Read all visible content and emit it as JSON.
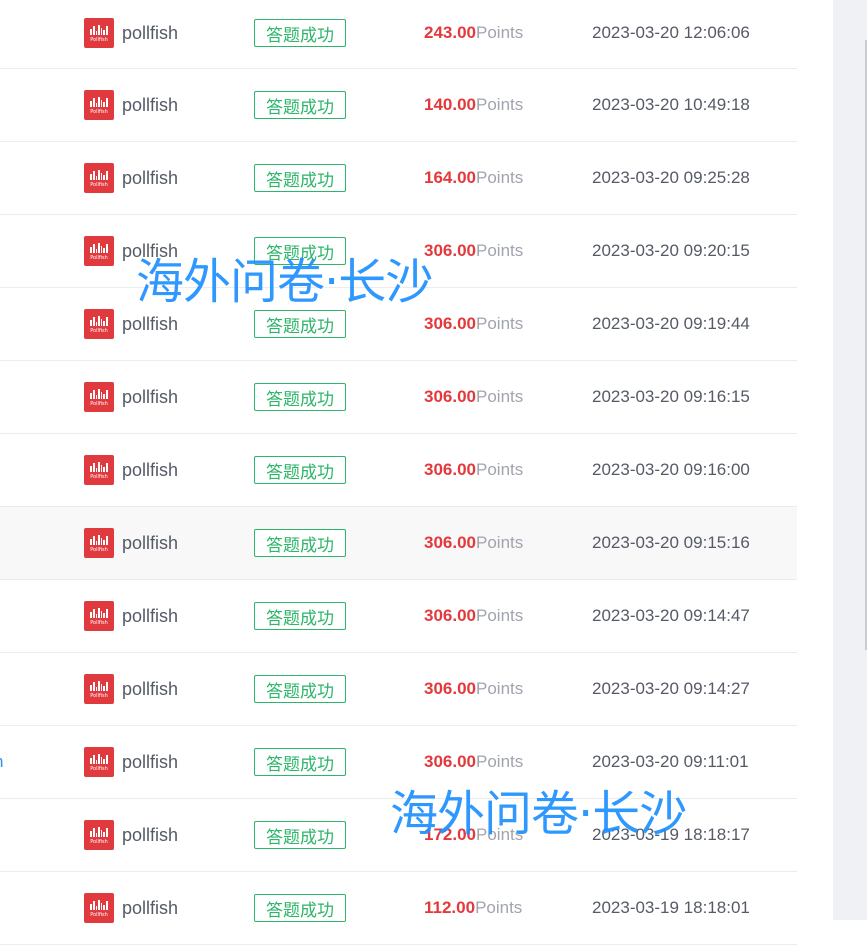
{
  "rows": [
    {
      "left_link": "",
      "vendor": "pollfish",
      "logo_text": "Pollfish",
      "status": "答题成功",
      "points": "243.00",
      "unit": "Points",
      "time": "2023-03-20 12:06:06",
      "highlight": false
    },
    {
      "left_link": "",
      "vendor": "pollfish",
      "logo_text": "Pollfish",
      "status": "答题成功",
      "points": "140.00",
      "unit": "Points",
      "time": "2023-03-20 10:49:18",
      "highlight": false
    },
    {
      "left_link": "",
      "vendor": "pollfish",
      "logo_text": "Pollfish",
      "status": "答题成功",
      "points": "164.00",
      "unit": "Points",
      "time": "2023-03-20 09:25:28",
      "highlight": false
    },
    {
      "left_link": "",
      "vendor": "pollfish",
      "logo_text": "Pollfish",
      "status": "答题成功",
      "points": "306.00",
      "unit": "Points",
      "time": "2023-03-20 09:20:15",
      "highlight": false
    },
    {
      "left_link": "",
      "vendor": "pollfish",
      "logo_text": "Pollfish",
      "status": "答题成功",
      "points": "306.00",
      "unit": "Points",
      "time": "2023-03-20 09:19:44",
      "highlight": false
    },
    {
      "left_link": "",
      "vendor": "pollfish",
      "logo_text": "Pollfish",
      "status": "答题成功",
      "points": "306.00",
      "unit": "Points",
      "time": "2023-03-20 09:16:15",
      "highlight": false
    },
    {
      "left_link": "",
      "vendor": "pollfish",
      "logo_text": "Pollfish",
      "status": "答题成功",
      "points": "306.00",
      "unit": "Points",
      "time": "2023-03-20 09:16:00",
      "highlight": false
    },
    {
      "left_link": "",
      "vendor": "pollfish",
      "logo_text": "Pollfish",
      "status": "答题成功",
      "points": "306.00",
      "unit": "Points",
      "time": "2023-03-20 09:15:16",
      "highlight": true
    },
    {
      "left_link": "",
      "vendor": "pollfish",
      "logo_text": "Pollfish",
      "status": "答题成功",
      "points": "306.00",
      "unit": "Points",
      "time": "2023-03-20 09:14:47",
      "highlight": false
    },
    {
      "left_link": "",
      "vendor": "pollfish",
      "logo_text": "Pollfish",
      "status": "答题成功",
      "points": "306.00",
      "unit": "Points",
      "time": "2023-03-20 09:14:27",
      "highlight": false
    },
    {
      "left_link": "h",
      "vendor": "pollfish",
      "logo_text": "Pollfish",
      "status": "答题成功",
      "points": "306.00",
      "unit": "Points",
      "time": "2023-03-20 09:11:01",
      "highlight": false
    },
    {
      "left_link": "",
      "vendor": "pollfish",
      "logo_text": "Pollfish",
      "status": "答题成功",
      "points": "172.00",
      "unit": "Points",
      "time": "2023-03-19 18:18:17",
      "highlight": false
    },
    {
      "left_link": "",
      "vendor": "pollfish",
      "logo_text": "Pollfish",
      "status": "答题成功",
      "points": "112.00",
      "unit": "Points",
      "time": "2023-03-19 18:18:01",
      "highlight": false
    }
  ],
  "watermarks": [
    "海外问卷·长沙",
    "海外问卷·长沙"
  ],
  "colors": {
    "points": "#e4393c",
    "status": "#2db56a",
    "logo": "#e0393e",
    "watermark": "#1e90ff"
  }
}
